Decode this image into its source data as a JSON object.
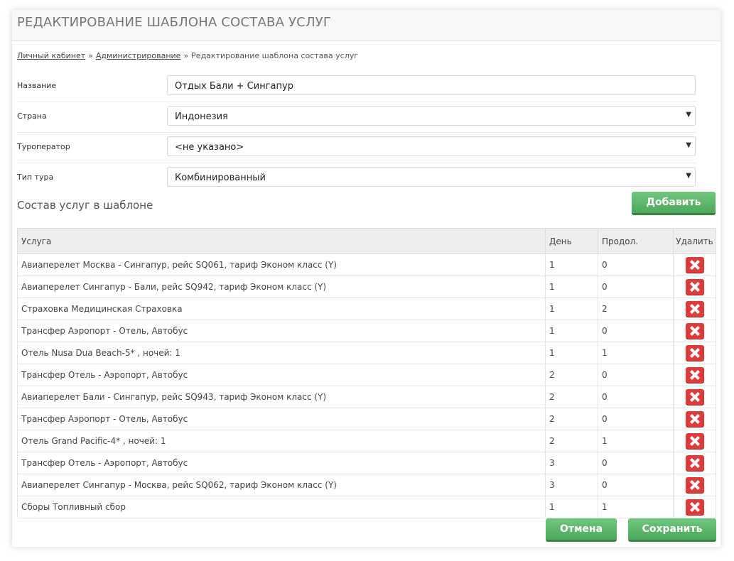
{
  "page": {
    "title": "РЕДАКТИРОВАНИЕ ШАБЛОНА СОСТАВА УСЛУГ"
  },
  "breadcrumb": {
    "home": "Личный кабинет",
    "admin": "Администрирование",
    "current": "Редактирование шаблона состава услуг",
    "separator": "»"
  },
  "form": {
    "name": {
      "label": "Название",
      "value": "Отдых Бали + Сингапур"
    },
    "country": {
      "label": "Страна",
      "value": "Индонезия"
    },
    "operator": {
      "label": "Туроператор",
      "value": "<не указано>"
    },
    "tour_type": {
      "label": "Тип тура",
      "value": "Комбинированный"
    }
  },
  "section": {
    "title": "Состав услуг в шаблоне",
    "add_label": "Добавить"
  },
  "table": {
    "headers": {
      "service": "Услуга",
      "day": "День",
      "duration": "Продол.",
      "delete": "Удалить"
    },
    "rows": [
      {
        "service": "Авиаперелет Москва - Сингапур, рейс SQ061, тариф Эконом класс (Y)",
        "day": "1",
        "duration": "0"
      },
      {
        "service": "Авиаперелет Сингапур - Бали, рейс SQ942, тариф Эконом класс (Y)",
        "day": "1",
        "duration": "0"
      },
      {
        "service": "Страховка Медицинская Страховка",
        "day": "1",
        "duration": "2"
      },
      {
        "service": "Трансфер Аэропорт - Отель, Автобус",
        "day": "1",
        "duration": "0"
      },
      {
        "service": "Отель Nusa Dua Beach-5* , ночей: 1",
        "day": "1",
        "duration": "1"
      },
      {
        "service": "Трансфер Отель - Аэропорт, Автобус",
        "day": "2",
        "duration": "0"
      },
      {
        "service": "Авиаперелет Бали - Сингапур, рейс SQ943, тариф Эконом класс (Y)",
        "day": "2",
        "duration": "0"
      },
      {
        "service": "Трансфер Аэропорт - Отель, Автобус",
        "day": "2",
        "duration": "0"
      },
      {
        "service": "Отель Grand Pacific-4* , ночей: 1",
        "day": "2",
        "duration": "1"
      },
      {
        "service": "Трансфер Отель - Аэропорт, Автобус",
        "day": "3",
        "duration": "0"
      },
      {
        "service": "Авиаперелет Сингапур - Москва, рейс SQ062, тариф Эконом класс (Y)",
        "day": "3",
        "duration": "0"
      },
      {
        "service": "Сборы Топливный сбор",
        "day": "1",
        "duration": "1"
      }
    ]
  },
  "actions": {
    "cancel_label": "Отмена",
    "save_label": "Сохранить"
  },
  "colors": {
    "accent_green": "#5bb868",
    "delete_red": "#e03a3a"
  },
  "icons": {
    "select_arrow": "chevron-down-icon",
    "delete": "close-icon"
  }
}
